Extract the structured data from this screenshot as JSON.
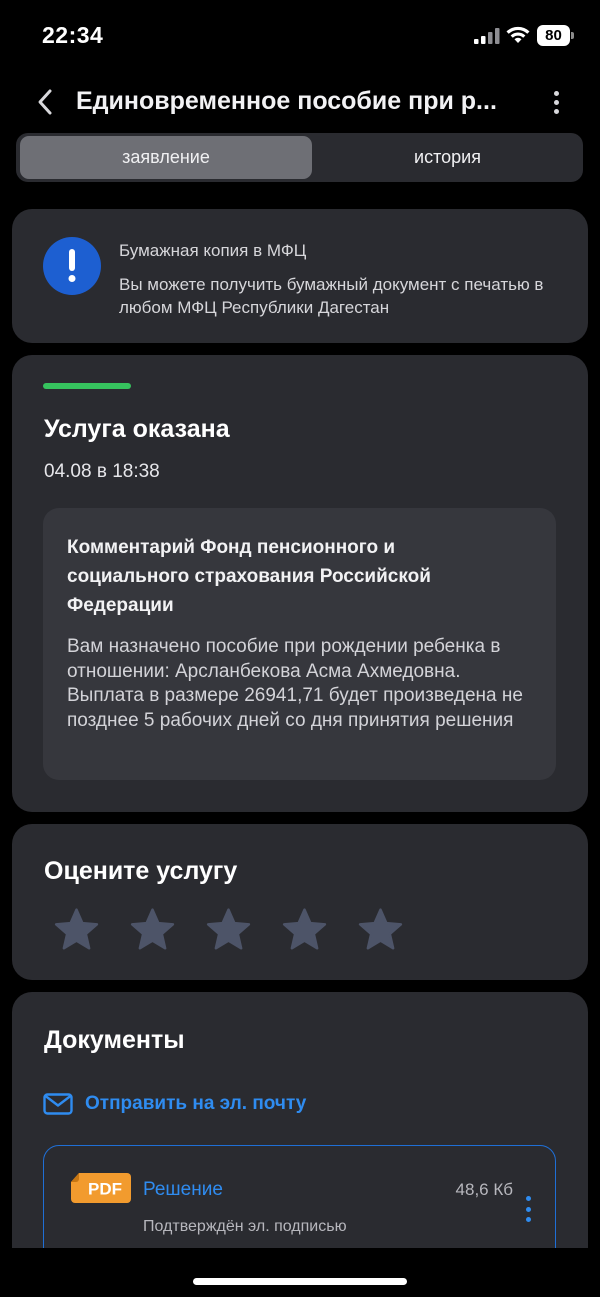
{
  "status_bar": {
    "time": "22:34",
    "battery": "80",
    "signal_icon": "cellular-signal-icon",
    "wifi_icon": "wifi-icon"
  },
  "header": {
    "back_icon": "chevron-left-icon",
    "title": "Единовременное пособие при р...",
    "more_icon": "more-vertical-icon"
  },
  "tabs": [
    {
      "label": "заявление",
      "active": true
    },
    {
      "label": "история",
      "active": false
    }
  ],
  "info_card": {
    "icon": "exclamation-icon",
    "title": "Бумажная копия в МФЦ",
    "text": "Вы можете получить бумажный документ с печатью в любом МФЦ Республики Дагестан",
    "accent": "#1d5fd1"
  },
  "status_card": {
    "title": "Услуга оказана",
    "date": "04.08 в 18:38",
    "progress_color": "#36c35e",
    "comment": {
      "title": "Комментарий Фонд пенсионного и социального страхования Российской Федерации",
      "text": "Вам назначено пособие при рождении ребенка в отношении: Арсланбекова Асма Ахмедовна. Выплата в размере 26941,71 будет произведена не позднее 5 рабочих дней со дня принятия решения"
    }
  },
  "rating_card": {
    "title": "Оцените услугу",
    "stars_total": 5,
    "stars_selected": 0,
    "star_icon": "star-icon"
  },
  "documents_card": {
    "title": "Документы",
    "email_icon": "mail-icon",
    "email_label": "Отправить на эл. почту",
    "items": [
      {
        "badge": "PDF",
        "name": "Решение",
        "size": "48,6 Кб",
        "subtitle": "Подтверждён эл. подписью",
        "badge_color": "#f29b2e"
      }
    ]
  },
  "colors": {
    "background": "#000000",
    "card": "#2a2b30",
    "link": "#2f8cf0"
  }
}
